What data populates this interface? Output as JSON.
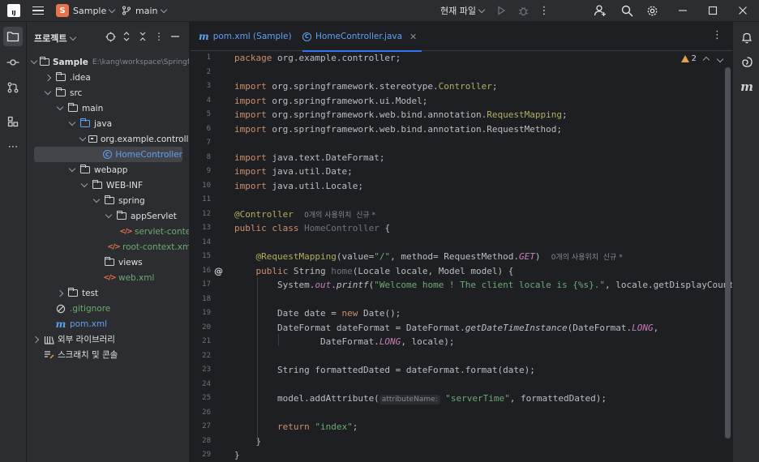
{
  "titlebar": {
    "app_logo": "IJ",
    "project_badge": "S",
    "project_name": "Sample",
    "branch": "main",
    "run_config": "현재 파일",
    "icons": [
      "hamburger-menu-icon",
      "branch-icon",
      "run-icon",
      "debug-icon",
      "more-icon",
      "add-user-icon",
      "search-icon",
      "settings-icon",
      "minimize-icon",
      "maximize-icon",
      "close-icon"
    ]
  },
  "left_strip": {
    "items": [
      "folder-icon",
      "commit-icon",
      "pull-request-icon",
      "structure-icon",
      "more-icon"
    ]
  },
  "project_panel": {
    "title": "프로젝트",
    "tree": [
      {
        "label": "Sample",
        "suffix": "E:\\kang\\workspace\\Springfr",
        "depth": 0,
        "arrow": "open",
        "icon": "module",
        "style": "bold"
      },
      {
        "label": ".idea",
        "depth": 1,
        "arrow": "closed",
        "icon": "folder"
      },
      {
        "label": "src",
        "depth": 1,
        "arrow": "open",
        "icon": "folder"
      },
      {
        "label": "main",
        "depth": 2,
        "arrow": "open",
        "icon": "folder"
      },
      {
        "label": "java",
        "depth": 3,
        "arrow": "open",
        "icon": "folder-blue"
      },
      {
        "label": "org.example.controller",
        "depth": 4,
        "arrow": "open",
        "icon": "package"
      },
      {
        "label": "HomeController",
        "depth": 5,
        "arrow": "none",
        "icon": "class",
        "style": "blue",
        "selected": true
      },
      {
        "label": "webapp",
        "depth": 3,
        "arrow": "open",
        "icon": "folder"
      },
      {
        "label": "WEB-INF",
        "depth": 4,
        "arrow": "open",
        "icon": "folder"
      },
      {
        "label": "spring",
        "depth": 5,
        "arrow": "open",
        "icon": "folder"
      },
      {
        "label": "appServlet",
        "depth": 6,
        "arrow": "open",
        "icon": "folder"
      },
      {
        "label": "servlet-context",
        "depth": 7,
        "arrow": "none",
        "icon": "xml",
        "style": "green"
      },
      {
        "label": "root-context.xml",
        "depth": 6,
        "arrow": "none",
        "icon": "xml",
        "style": "green"
      },
      {
        "label": "views",
        "depth": 5,
        "arrow": "none",
        "icon": "folder"
      },
      {
        "label": "web.xml",
        "depth": 5,
        "arrow": "none",
        "icon": "xml",
        "style": "green"
      },
      {
        "label": "test",
        "depth": 2,
        "arrow": "closed",
        "icon": "folder"
      },
      {
        "label": ".gitignore",
        "depth": 1,
        "arrow": "none",
        "icon": "ignore",
        "style": "green"
      },
      {
        "label": "pom.xml",
        "depth": 1,
        "arrow": "none",
        "icon": "maven",
        "style": "blue"
      },
      {
        "label": "외부 라이브러리",
        "depth": 0,
        "arrow": "closed",
        "icon": "library"
      },
      {
        "label": "스크래치 및 콘솔",
        "depth": 0,
        "arrow": "none",
        "icon": "scratch"
      }
    ]
  },
  "editor": {
    "tabs": [
      {
        "label": "pom.xml (Sample)",
        "icon": "maven-icon",
        "active": false
      },
      {
        "label": "HomeController.java",
        "icon": "class-icon",
        "active": true
      }
    ],
    "warnings": "2",
    "usage_hint": "0개의 사용위치",
    "new_hint": "신규 *",
    "param_hint": "attributeName:",
    "line_numbers": [
      "1",
      "2",
      "3",
      "4",
      "5",
      "6",
      "7",
      "8",
      "9",
      "10",
      "11",
      "12",
      "13",
      "14",
      "15",
      "16",
      "17",
      "18",
      "19",
      "20",
      "21",
      "22",
      "23",
      "24",
      "25",
      "26",
      "27",
      "28",
      "29"
    ],
    "code": [
      "package org.example.controller;",
      "",
      "import org.springframework.stereotype.Controller;",
      "import org.springframework.ui.Model;",
      "import org.springframework.web.bind.annotation.RequestMapping;",
      "import org.springframework.web.bind.annotation.RequestMethod;",
      "",
      "import java.text.DateFormat;",
      "import java.util.Date;",
      "import java.util.Locale;",
      "",
      "@Controller",
      "public class HomeController {",
      "",
      "    @RequestMapping(value=\"/\", method= RequestMethod.GET)",
      "    public String home(Locale locale, Model model) {",
      "        System.out.printf(\"Welcome home ! The client locale is {%s}.\", locale.getDisplayCountry());",
      "",
      "        Date date = new Date();",
      "        DateFormat dateFormat = DateFormat.getDateTimeInstance(DateFormat.LONG,",
      "                DateFormat.LONG, locale);",
      "",
      "        String formattedDated = dateFormat.format(date);",
      "",
      "        model.addAttribute(\"serverTime\", formattedDated);",
      "",
      "        return \"index\";",
      "    }",
      "}"
    ]
  },
  "right_strip": {
    "items": [
      "notifications-icon",
      "ai-assistant-icon",
      "maven-icon"
    ]
  }
}
